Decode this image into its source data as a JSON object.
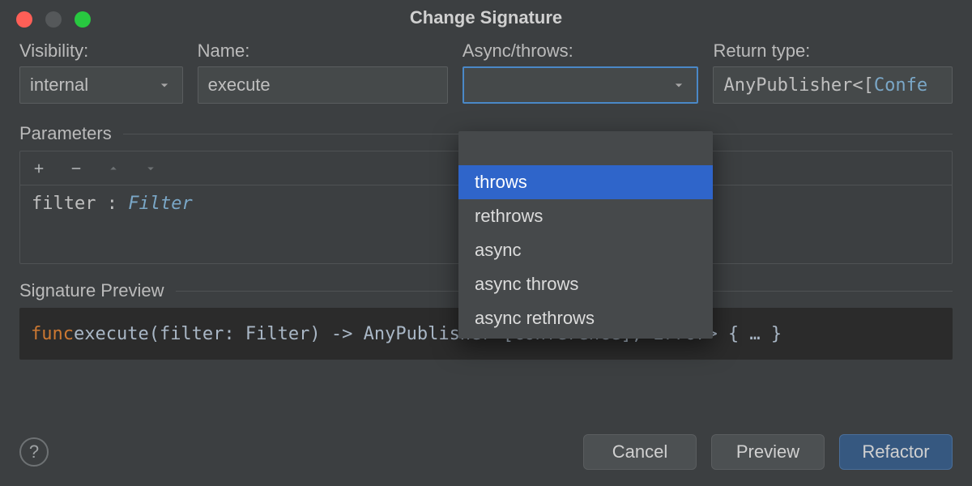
{
  "title": "Change Signature",
  "labels": {
    "visibility": "Visibility:",
    "name": "Name:",
    "async_throws": "Async/throws:",
    "return_type": "Return type:",
    "parameters": "Parameters",
    "signature_preview": "Signature Preview"
  },
  "values": {
    "visibility": "internal",
    "name": "execute",
    "async_throws": "",
    "return_type_display": "AnyPublisher<[Confe"
  },
  "async_throws_options": {
    "blank": "",
    "throws": "throws",
    "rethrows": "rethrows",
    "async": "async",
    "async_throws": "async throws",
    "async_rethrows": "async rethrows"
  },
  "parameters": [
    {
      "name": "filter",
      "type": "Filter"
    }
  ],
  "parameters_display": {
    "line0_name": "filter ",
    "line0_sep": ": ",
    "line0_type": "Filter"
  },
  "signature_preview": {
    "kw": "func",
    "rest": " execute(filter: Filter) -> AnyPublisher<[Conference], Error> { … }"
  },
  "buttons": {
    "help": "?",
    "cancel": "Cancel",
    "preview": "Preview",
    "refactor": "Refactor"
  },
  "icons": {
    "add": "plus-icon",
    "remove": "minus-icon",
    "up": "chevron-up-icon",
    "down": "chevron-down-icon",
    "chevron": "chevron-down-icon"
  }
}
